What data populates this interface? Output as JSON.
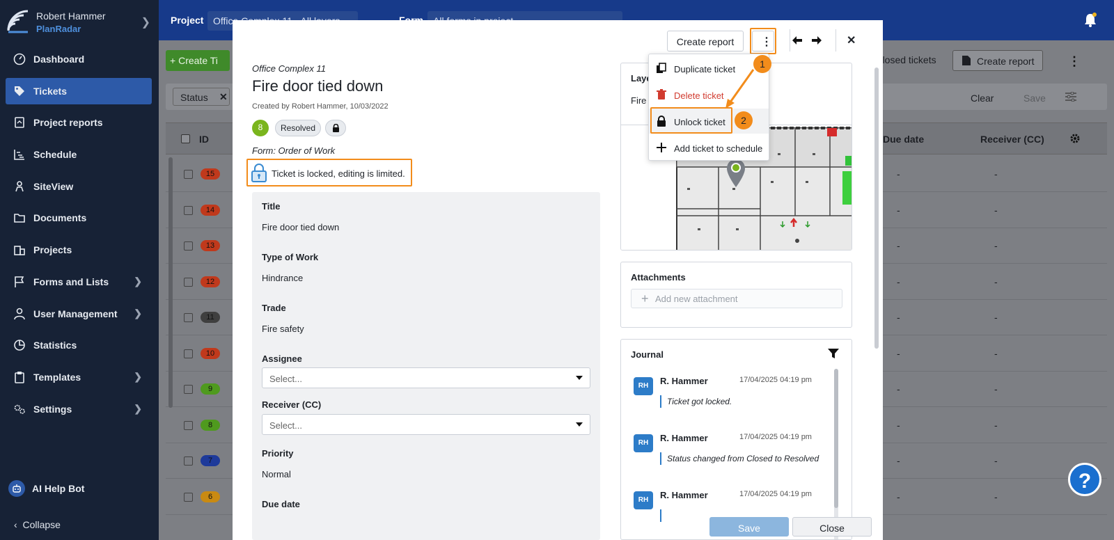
{
  "sidebar": {
    "user_name": "Robert Hammer",
    "brand": "PlanRadar",
    "items": [
      {
        "label": "Dashboard",
        "icon": "dashboard-icon"
      },
      {
        "label": "Tickets",
        "icon": "tag-icon",
        "active": true
      },
      {
        "label": "Project reports",
        "icon": "report-icon"
      },
      {
        "label": "Schedule",
        "icon": "schedule-icon"
      },
      {
        "label": "SiteView",
        "icon": "siteview-icon"
      },
      {
        "label": "Documents",
        "icon": "folder-icon"
      },
      {
        "label": "Projects",
        "icon": "buildings-icon"
      },
      {
        "label": "Forms and Lists",
        "icon": "flag-icon",
        "has_children": true
      },
      {
        "label": "User Management",
        "icon": "user-icon",
        "has_children": true
      },
      {
        "label": "Statistics",
        "icon": "pie-chart-icon"
      },
      {
        "label": "Templates",
        "icon": "clipboard-icon",
        "has_children": true
      },
      {
        "label": "Settings",
        "icon": "gears-icon",
        "has_children": true
      }
    ],
    "ai_bot": "AI Help Bot",
    "collapse": "Collapse"
  },
  "topbar": {
    "project_label": "Project",
    "project_value": "Office Complex 11 - All layers",
    "form_label": "Form",
    "form_value": "All forms in project"
  },
  "background": {
    "create_ticket": "Create Ti",
    "hide_closed": "ide closed tickets",
    "create_report": "Create report",
    "status_chip": "Status",
    "clear": "Clear",
    "save": "Save",
    "col_id": "ID",
    "col_due": "Due date",
    "col_receiver": "Receiver (CC)",
    "rows": [
      {
        "id": "15",
        "color": "#c0391c"
      },
      {
        "id": "14",
        "color": "#c0391c"
      },
      {
        "id": "13",
        "color": "#c0391c"
      },
      {
        "id": "12",
        "color": "#c0391c"
      },
      {
        "id": "11",
        "color": "#3f3f3f"
      },
      {
        "id": "10",
        "color": "#c0391c"
      },
      {
        "id": "9",
        "color": "#4f9a1e"
      },
      {
        "id": "8",
        "color": "#4f9a1e"
      },
      {
        "id": "7",
        "color": "#1e3a9a"
      },
      {
        "id": "6",
        "color": "#c98a12"
      }
    ],
    "dash": "-"
  },
  "modal": {
    "create_report": "Create report",
    "project": "Office Complex 11",
    "title": "Fire door tied down",
    "created": "Created by Robert Hammer, 10/03/2022",
    "priority_badge": "8",
    "status": "Resolved",
    "form": "Form: Order of Work",
    "locked_message": "Ticket is locked, editing is limited.",
    "fields": {
      "title_label": "Title",
      "title_value": "Fire door tied down",
      "type_label": "Type of Work",
      "type_value": "Hindrance",
      "trade_label": "Trade",
      "trade_value": "Fire safety",
      "assignee_label": "Assignee",
      "assignee_placeholder": "Select...",
      "receiver_label": "Receiver (CC)",
      "receiver_placeholder": "Select...",
      "priority_label": "Priority",
      "priority_value": "Normal",
      "due_label": "Due date"
    },
    "layer_header": "Laye",
    "layer_name": "Fire",
    "attachments_header": "Attachments",
    "add_attachment": "Add new attachment",
    "journal_header": "Journal",
    "journal": [
      {
        "initials": "RH",
        "name": "R. Hammer",
        "date": "17/04/2025 04:19 pm",
        "message": "Ticket got locked."
      },
      {
        "initials": "RH",
        "name": "R. Hammer",
        "date": "17/04/2025 04:19 pm",
        "message": "Status changed from Closed to Resolved"
      },
      {
        "initials": "RH",
        "name": "R. Hammer",
        "date": "17/04/2025 04:19 pm",
        "message": ""
      }
    ],
    "save": "Save",
    "close": "Close"
  },
  "menu": {
    "items": [
      {
        "label": "Duplicate ticket",
        "color": "#1f2329"
      },
      {
        "label": "Delete ticket",
        "color": "#d13b2f"
      },
      {
        "label": "Unlock ticket",
        "color": "#1f2329"
      },
      {
        "label": "Add ticket to schedule",
        "color": "#1f2329"
      }
    ]
  },
  "annotations": {
    "step1": "1",
    "step2": "2"
  },
  "help": "?",
  "colors": {
    "accent": "#2d5aa8",
    "highlight": "#f28c1b",
    "sidebar": "#172236",
    "topbar": "#173a8a"
  }
}
